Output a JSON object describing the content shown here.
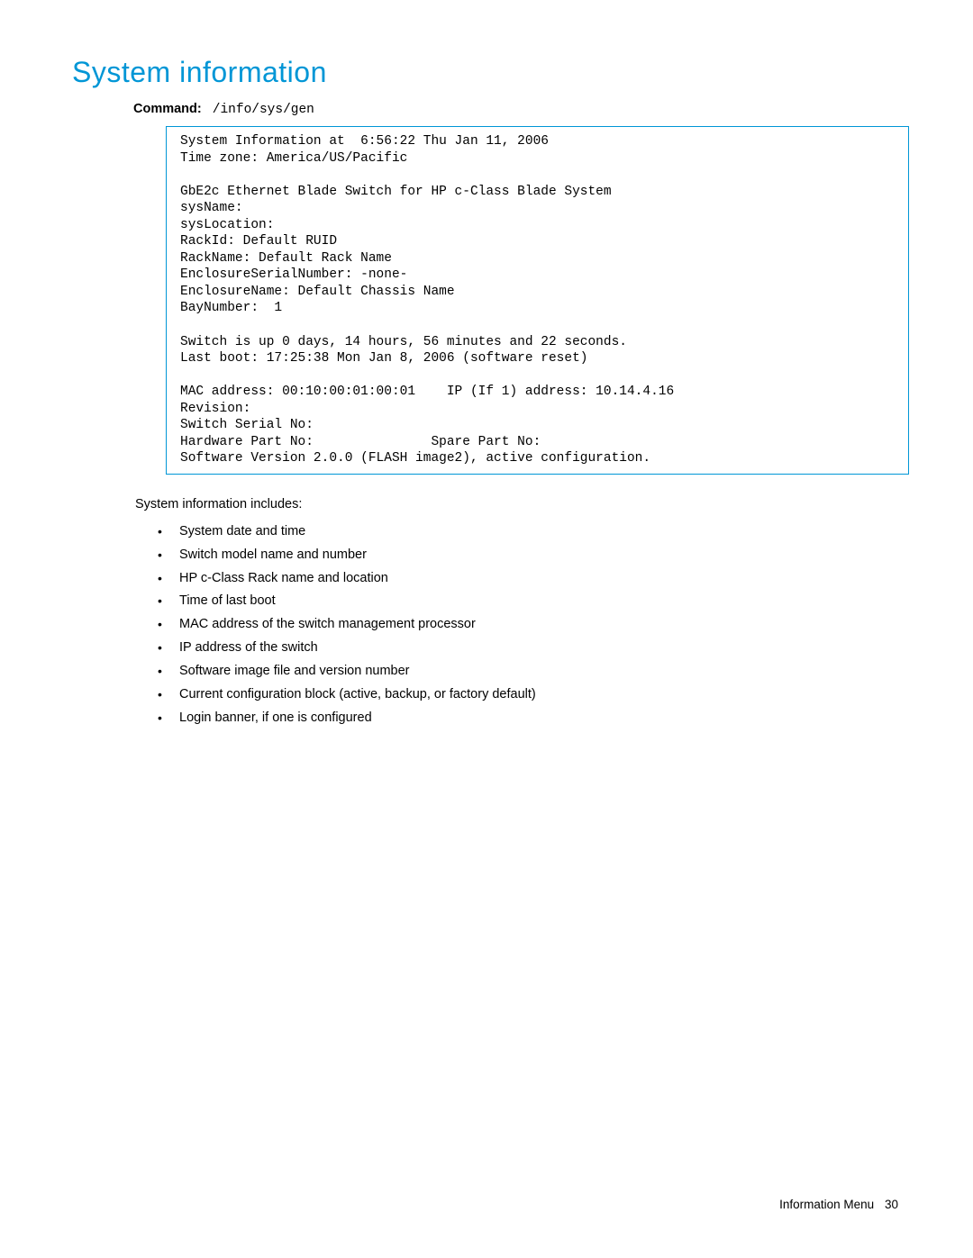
{
  "title": "System information",
  "command": {
    "label": "Command:",
    "value": "/info/sys/gen"
  },
  "codebox": "System Information at  6:56:22 Thu Jan 11, 2006\nTime zone: America/US/Pacific\n\nGbE2c Ethernet Blade Switch for HP c-Class Blade System\nsysName:\nsysLocation:\nRackId: Default RUID\nRackName: Default Rack Name\nEnclosureSerialNumber: -none-\nEnclosureName: Default Chassis Name\nBayNumber:  1\n\nSwitch is up 0 days, 14 hours, 56 minutes and 22 seconds.\nLast boot: 17:25:38 Mon Jan 8, 2006 (software reset)\n\nMAC address: 00:10:00:01:00:01    IP (If 1) address: 10.14.4.16\nRevision:\nSwitch Serial No:\nHardware Part No:               Spare Part No:\nSoftware Version 2.0.0 (FLASH image2), active configuration.",
  "intro": "System information includes:",
  "bullets": [
    "System date and time",
    "Switch model name and number",
    "HP c-Class Rack name and location",
    "Time of last boot",
    "MAC address of the switch management processor",
    "IP address of the switch",
    "Software image file and version number",
    "Current configuration block (active, backup, or factory default)",
    "Login banner, if one is configured"
  ],
  "footer": {
    "section": "Information Menu",
    "page": "30"
  }
}
